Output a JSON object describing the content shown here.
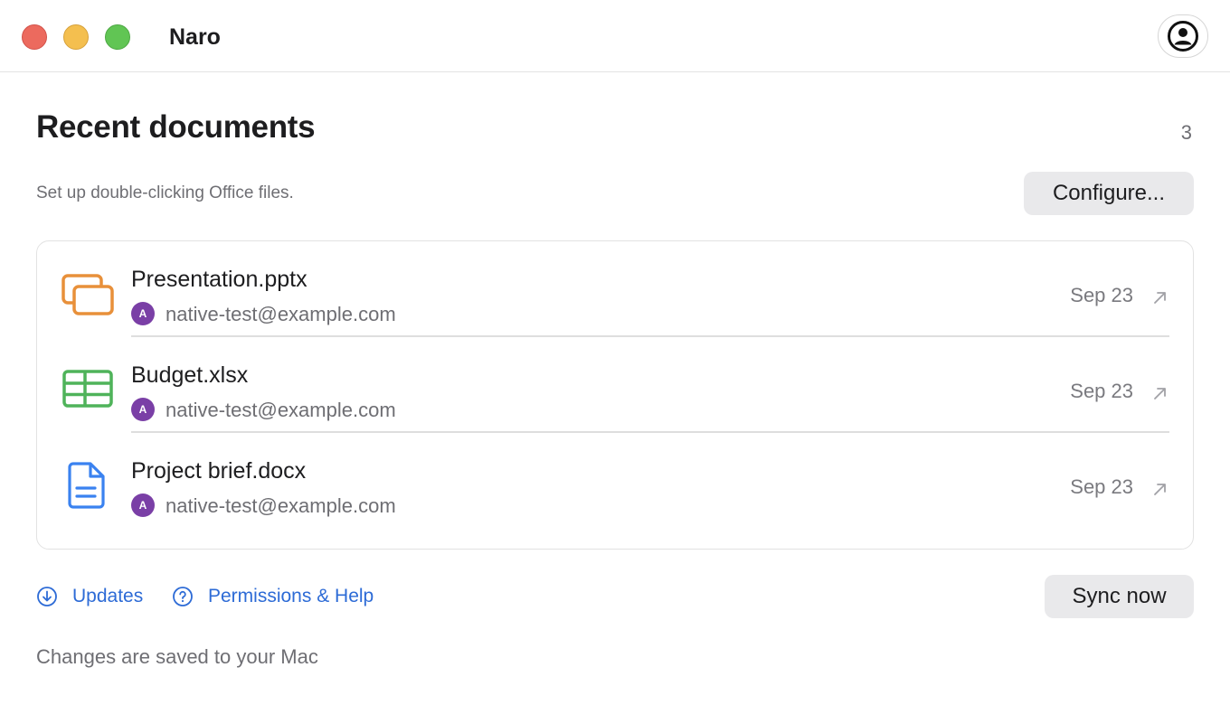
{
  "app": {
    "title": "Naro"
  },
  "header": {
    "account_icon": "person-circle-icon"
  },
  "main": {
    "title": "Recent documents",
    "count": "3",
    "subtitle": "Set up double-clicking Office files.",
    "configure_label": "Configure..."
  },
  "documents": [
    {
      "name": "Presentation.pptx",
      "owner_initial": "A",
      "owner": "native-test@example.com",
      "date": "Sep 23",
      "icon": "presentation-icon",
      "icon_color": "#e8903a"
    },
    {
      "name": "Budget.xlsx",
      "owner_initial": "A",
      "owner": "native-test@example.com",
      "date": "Sep 23",
      "icon": "spreadsheet-icon",
      "icon_color": "#4fb35a"
    },
    {
      "name": "Project brief.docx",
      "owner_initial": "A",
      "owner": "native-test@example.com",
      "date": "Sep 23",
      "icon": "document-icon",
      "icon_color": "#3a82f0"
    }
  ],
  "footer": {
    "updates_label": "Updates",
    "help_label": "Permissions & Help",
    "sync_label": "Sync now",
    "status": "Changes are saved to your Mac"
  },
  "colors": {
    "accent_link": "#2d6bd6",
    "avatar": "#7a3fa6"
  }
}
